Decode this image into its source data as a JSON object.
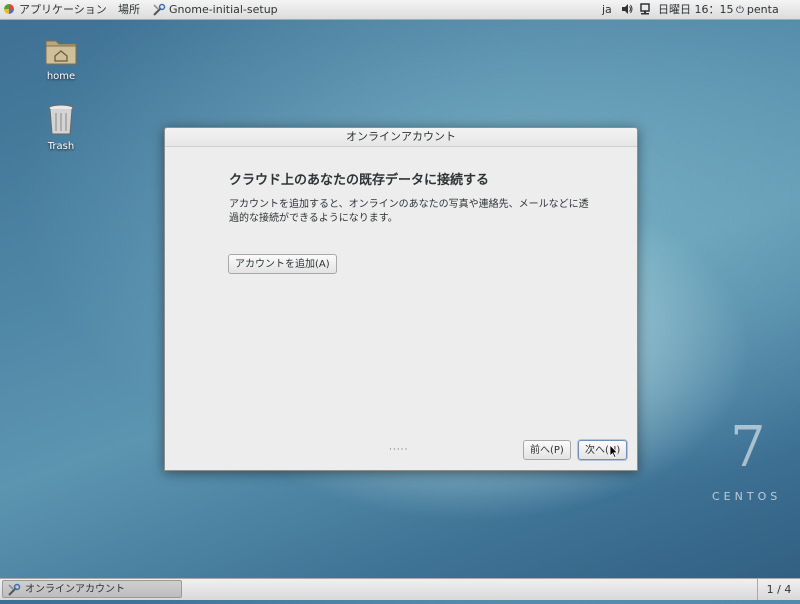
{
  "topbar": {
    "applications_label": "アプリケーション",
    "places_label": "場所",
    "window_label": "Gnome-initial-setup",
    "language": "ja",
    "clock": "日曜日 16：15",
    "user": "penta"
  },
  "desktop": {
    "icons": [
      {
        "label": "home",
        "icon": "home-folder-icon"
      },
      {
        "label": "Trash",
        "icon": "trash-icon"
      }
    ],
    "watermark_number": "7",
    "watermark_word": "CENTOS"
  },
  "dialog": {
    "title": "オンラインアカウント",
    "heading": "クラウド上のあなたの既存データに接続する",
    "description": "アカウントを追加すると、オンラインのあなたの写真や連絡先、メールなどに透過的な接続ができるようになります。",
    "add_account_button": "アカウントを追加(A)",
    "page_dots": "·····",
    "prev_button": "前へ(P)",
    "next_button": "次へ(N)"
  },
  "bottombar": {
    "task_label": "オンラインアカウント",
    "workspace": "1 / 4"
  }
}
